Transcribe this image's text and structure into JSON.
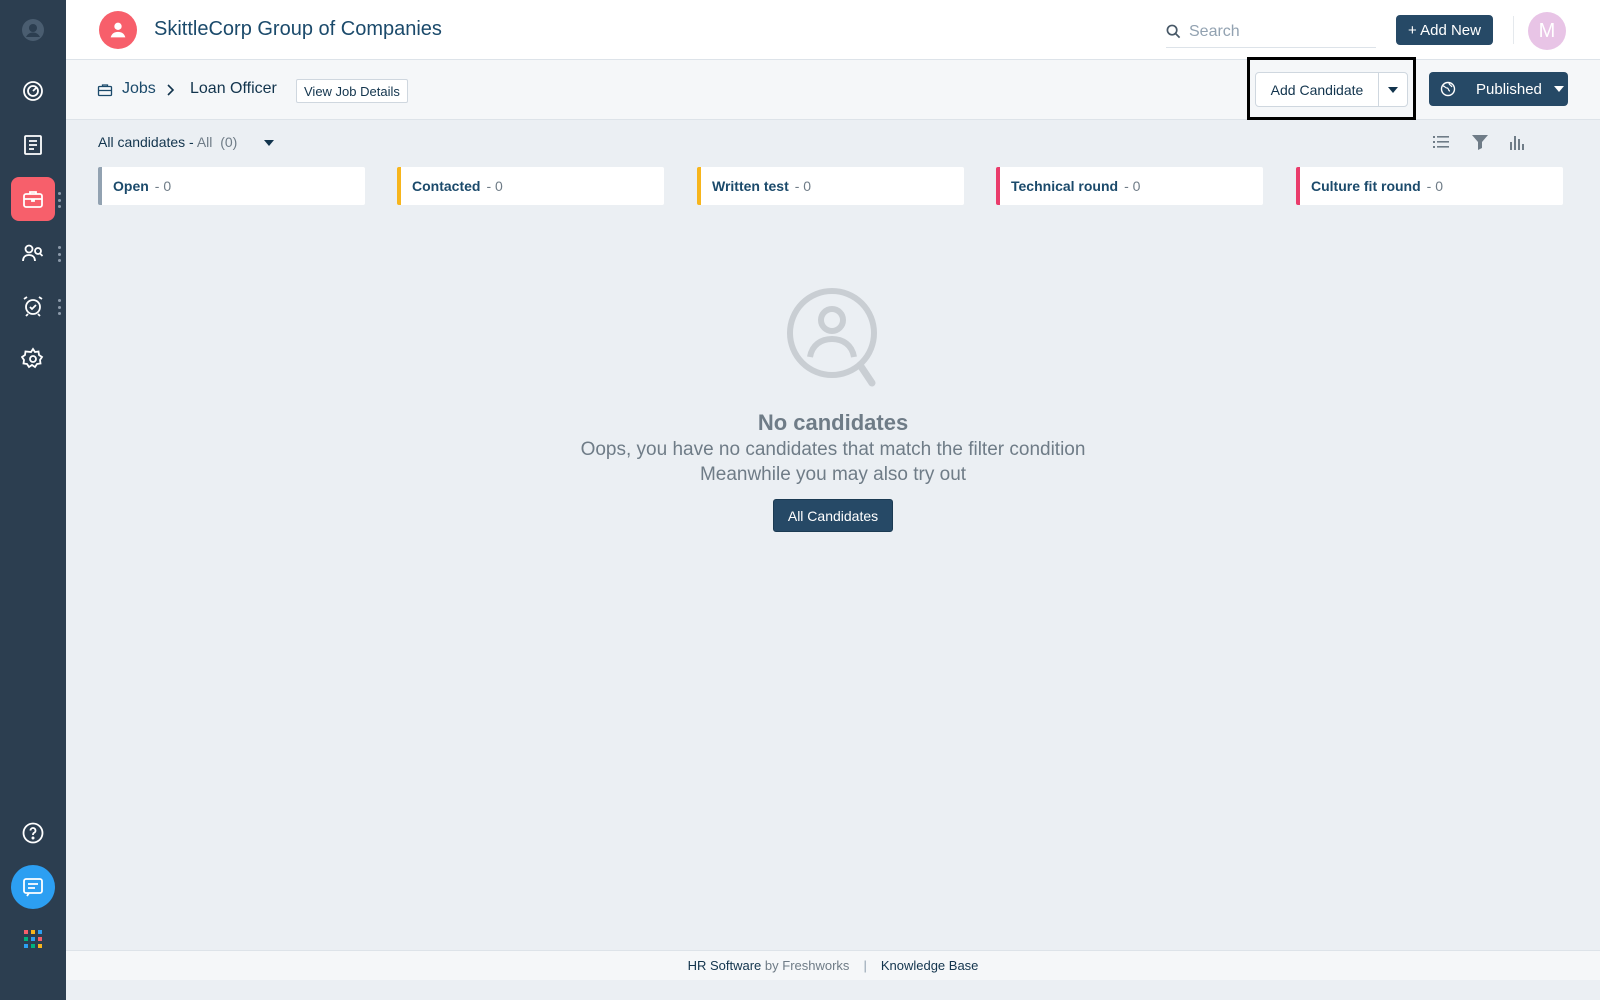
{
  "header": {
    "org_name": "SkittleCorp Group of Companies",
    "search_placeholder": "Search",
    "add_new_label": "+ Add New",
    "avatar_initial": "M"
  },
  "breadcrumb": {
    "root": "Jobs",
    "current": "Loan Officer",
    "view_details_label": "View Job Details"
  },
  "actions": {
    "add_candidate_label": "Add Candidate",
    "published_label": "Published"
  },
  "filter": {
    "label": "All candidates - ",
    "selected": "All",
    "count": "(0)"
  },
  "stages": [
    {
      "name": "Open",
      "count": "- 0",
      "color": "#92a2b1"
    },
    {
      "name": "Contacted",
      "count": "- 0",
      "color": "#f7b51c"
    },
    {
      "name": "Written test",
      "count": "- 0",
      "color": "#f7b51c"
    },
    {
      "name": "Technical round",
      "count": "- 0",
      "color": "#ea3c6b"
    },
    {
      "name": "Culture fit round",
      "count": "- 0",
      "color": "#ea3c6b"
    }
  ],
  "empty_state": {
    "title": "No candidates",
    "line1": "Oops, you have no candidates that match the filter condition",
    "line2": "Meanwhile you may also try out",
    "button_label": "All Candidates"
  },
  "footer": {
    "product": "HR Software",
    "by": "by Freshworks",
    "separator": "|",
    "knowledge_base": "Knowledge Base"
  },
  "colors": {
    "sidebar_bg": "#2c3e50",
    "accent_red": "#f75f6b",
    "primary_button": "#264966",
    "chat_blue": "#2c9ff2"
  },
  "icons": {
    "sidebar": [
      "app-logo-icon",
      "dashboard-icon",
      "notes-icon",
      "briefcase-icon",
      "candidates-icon",
      "alarm-clock-icon",
      "gear-icon",
      "help-icon",
      "chat-icon",
      "apps-grid-icon"
    ],
    "toolbar": [
      "list-view-icon",
      "filter-icon",
      "bar-chart-icon"
    ]
  }
}
